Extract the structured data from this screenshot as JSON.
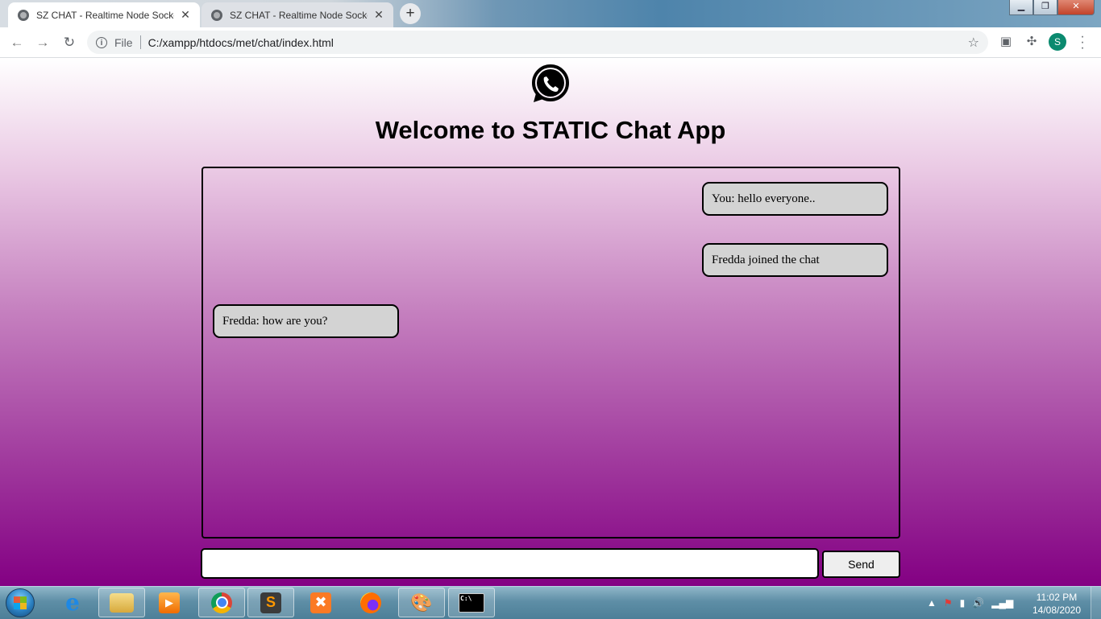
{
  "browser": {
    "tabs": [
      {
        "title": "SZ CHAT - Realtime Node Socket",
        "active": true
      },
      {
        "title": "SZ CHAT - Realtime Node Socket",
        "active": false
      }
    ],
    "new_tab_label": "+",
    "omnibox": {
      "scheme_label": "File",
      "url": "C:/xampp/htdocs/met/chat/index.html"
    },
    "profile_initial": "S"
  },
  "page": {
    "title": "Welcome to STATIC Chat App",
    "logo_icon": "whatsapp-icon",
    "messages": [
      {
        "text": "You: hello everyone..",
        "side": "right"
      },
      {
        "text": "Fredda joined the chat",
        "side": "right"
      },
      {
        "text": "Fredda: how are you?",
        "side": "left"
      }
    ],
    "composer": {
      "value": "",
      "placeholder": ""
    },
    "send_label": "Send",
    "colors": {
      "gradient_top": "#ffffff",
      "gradient_bottom": "#830083",
      "bubble": "#d3d3d3"
    }
  },
  "taskbar": {
    "apps": [
      "start-orb",
      "internet-explorer",
      "file-explorer",
      "media-player",
      "chrome",
      "sublime-text",
      "xampp",
      "firefox",
      "paint",
      "command-prompt"
    ],
    "clock": {
      "time": "11:02 PM",
      "date": "14/08/2020"
    }
  }
}
